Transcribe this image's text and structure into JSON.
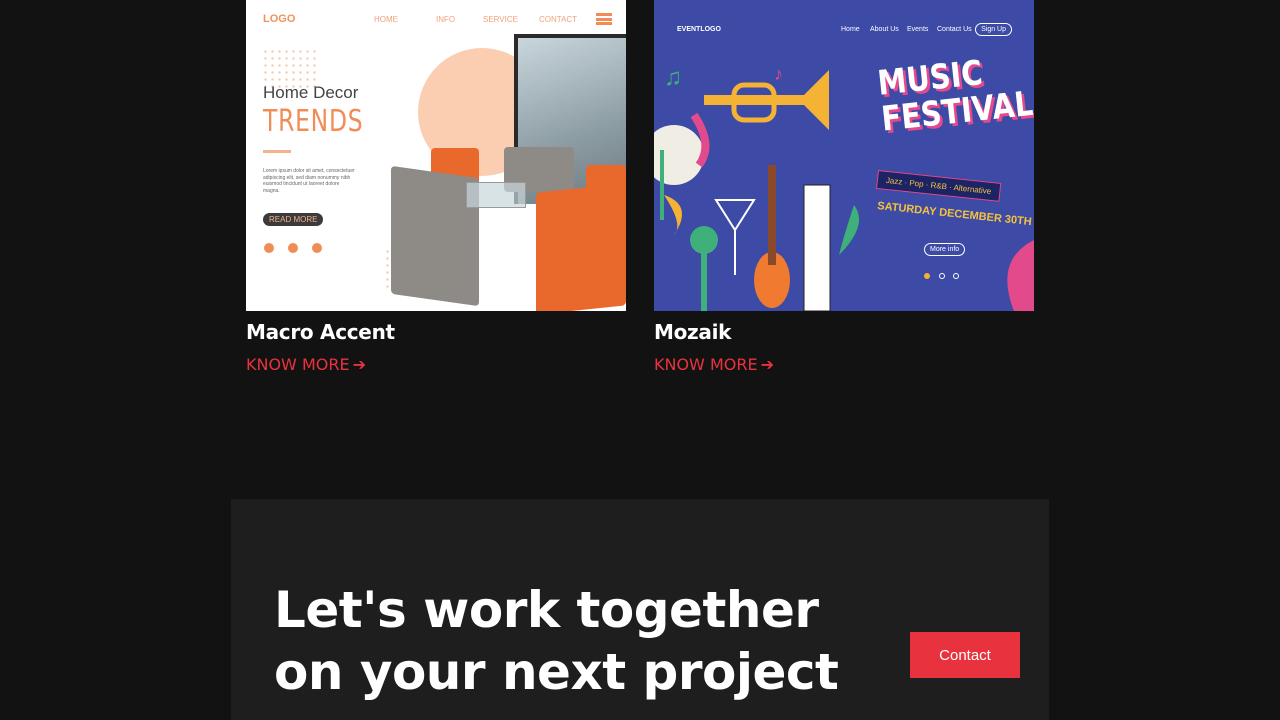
{
  "projects": [
    {
      "title": "Macro Accent",
      "link_label": "KNOW MORE",
      "thumbnail": {
        "logo": "LOGO",
        "nav": [
          "HOME",
          "INFO",
          "SERVICE",
          "CONTACT"
        ],
        "heading_line1": "Home  Decor",
        "heading_line2": "TRENDS",
        "body_text": "Lorem ipsum dolor sit amet, consectetuer adipiscing elit, sed diam nonummy nibh euismod tincidunt ut laoreet dolore magna.",
        "button_label": "READ MORE",
        "accent_color": "#f08c55"
      }
    },
    {
      "title": "Mozaik",
      "link_label": "KNOW MORE",
      "thumbnail": {
        "logo": "EVENTLOGO",
        "nav": [
          "Home",
          "About Us",
          "Events",
          "Contact Us"
        ],
        "signup_label": "Sign Up",
        "heading_line1": "MUSIC",
        "heading_line2": "FESTIVAL",
        "genres": "Jazz · Pop · R&B · Alternative",
        "date": "SATURDAY DECEMBER 30TH",
        "button_label": "More info",
        "accent_color": "#3d4aa6"
      }
    }
  ],
  "cta": {
    "heading": "Let's work together on your next project",
    "button_label": "Contact"
  },
  "colors": {
    "background": "#121212",
    "panel": "#1e1e1e",
    "accent": "#e8333f",
    "text": "#ffffff"
  },
  "icons": [
    "arrow-right-icon",
    "menu-icon",
    "facebook-icon",
    "twitter-icon",
    "instagram-icon"
  ]
}
